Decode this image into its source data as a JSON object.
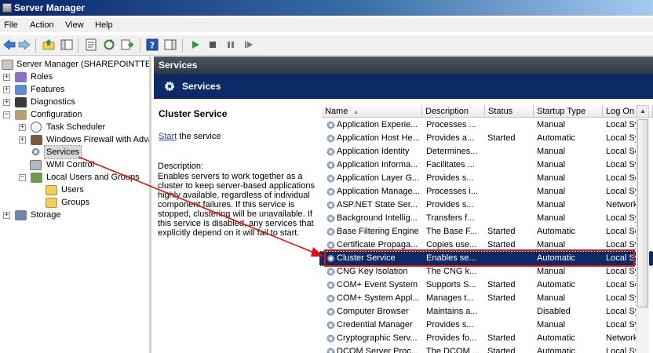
{
  "window": {
    "title": "Server Manager"
  },
  "menu": [
    "File",
    "Action",
    "View",
    "Help"
  ],
  "tree": {
    "root": "Server Manager (SHAREPOINTTES",
    "roles": "Roles",
    "features": "Features",
    "diagnostics": "Diagnostics",
    "configuration": "Configuration",
    "task_scheduler": "Task Scheduler",
    "firewall": "Windows Firewall with Adva",
    "services": "Services",
    "wmi": "WMI Control",
    "local_users": "Local Users and Groups",
    "users": "Users",
    "groups": "Groups",
    "storage": "Storage"
  },
  "panel": {
    "header": "Services",
    "banner": "Services"
  },
  "detail": {
    "title": "Cluster Service",
    "start_link": "Start",
    "start_rest": " the service",
    "desc_label": "Description:",
    "desc_text": "Enables servers to work together as a cluster to keep server-based applications highly available, regardless of individual component failures. If this service is stopped, clustering will be unavailable. If this service is disabled, any services that explicitly depend on it will fail to start."
  },
  "columns": {
    "name": "Name",
    "description": "Description",
    "status": "Status",
    "startup": "Startup Type",
    "logon": "Log On"
  },
  "rows": [
    {
      "name": "Application Experie...",
      "desc": "Processes ...",
      "status": "",
      "startup": "Manual",
      "logon": "Local Sy"
    },
    {
      "name": "Application Host He...",
      "desc": "Provides a...",
      "status": "Started",
      "startup": "Automatic",
      "logon": "Local Sy"
    },
    {
      "name": "Application Identity",
      "desc": "Determines...",
      "status": "",
      "startup": "Manual",
      "logon": "Local Se"
    },
    {
      "name": "Application Informa...",
      "desc": "Facilitates ...",
      "status": "",
      "startup": "Manual",
      "logon": "Local Sy"
    },
    {
      "name": "Application Layer G...",
      "desc": "Provides s...",
      "status": "",
      "startup": "Manual",
      "logon": "Local Se"
    },
    {
      "name": "Application Manage...",
      "desc": "Processes i...",
      "status": "",
      "startup": "Manual",
      "logon": "Local Sy"
    },
    {
      "name": "ASP.NET State Ser...",
      "desc": "Provides s...",
      "status": "",
      "startup": "Manual",
      "logon": "Network"
    },
    {
      "name": "Background Intellig...",
      "desc": "Transfers f...",
      "status": "",
      "startup": "Manual",
      "logon": "Local Sy"
    },
    {
      "name": "Base Filtering Engine",
      "desc": "The Base F...",
      "status": "Started",
      "startup": "Automatic",
      "logon": "Local Se"
    },
    {
      "name": "Certificate Propaga...",
      "desc": "Copies use...",
      "status": "Started",
      "startup": "Manual",
      "logon": "Local Sy"
    },
    {
      "name": "Cluster Service",
      "desc": "Enables se...",
      "status": "",
      "startup": "Automatic",
      "logon": "Local Sy",
      "selected": true
    },
    {
      "name": "CNG Key Isolation",
      "desc": "The CNG k...",
      "status": "",
      "startup": "Manual",
      "logon": "Local Sy"
    },
    {
      "name": "COM+ Event System",
      "desc": "Supports S...",
      "status": "Started",
      "startup": "Automatic",
      "logon": "Local Se"
    },
    {
      "name": "COM+ System Appl...",
      "desc": "Manages t...",
      "status": "Started",
      "startup": "Manual",
      "logon": "Local Sy"
    },
    {
      "name": "Computer Browser",
      "desc": "Maintains a...",
      "status": "",
      "startup": "Disabled",
      "logon": "Local Sy"
    },
    {
      "name": "Credential Manager",
      "desc": "Provides s...",
      "status": "",
      "startup": "Manual",
      "logon": "Local Sy"
    },
    {
      "name": "Cryptographic Serv...",
      "desc": "Provides fo...",
      "status": "Started",
      "startup": "Automatic",
      "logon": "Network"
    },
    {
      "name": "DCOM Server Proc...",
      "desc": "The DCOM ...",
      "status": "Started",
      "startup": "Automatic",
      "logon": "Local Sy"
    }
  ],
  "colors": {
    "accent": "#0c2a66",
    "highlight": "#e01010",
    "header": "#3a4550"
  }
}
